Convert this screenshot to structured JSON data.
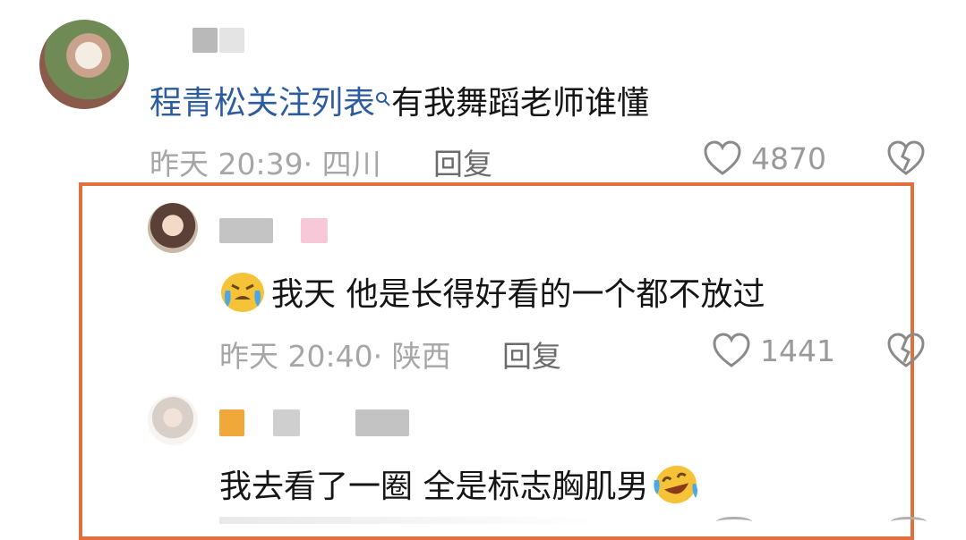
{
  "comments": [
    {
      "mention_link": "程青松关注列表",
      "text": "有我舞蹈老师谁懂",
      "time": "昨天 20:39",
      "location": "四川",
      "reply_label": "回复",
      "likes": "4870"
    },
    {
      "text": "我天 他是长得好看的一个都不放过",
      "time": "昨天 20:40",
      "location": "陕西",
      "reply_label": "回复",
      "likes": "1441"
    },
    {
      "text": "我去看了一圈  全是标志胸肌男"
    }
  ],
  "colors": {
    "highlight_border": "#e2703e",
    "link": "#2d5c9e",
    "meta": "#a6a6a6"
  }
}
